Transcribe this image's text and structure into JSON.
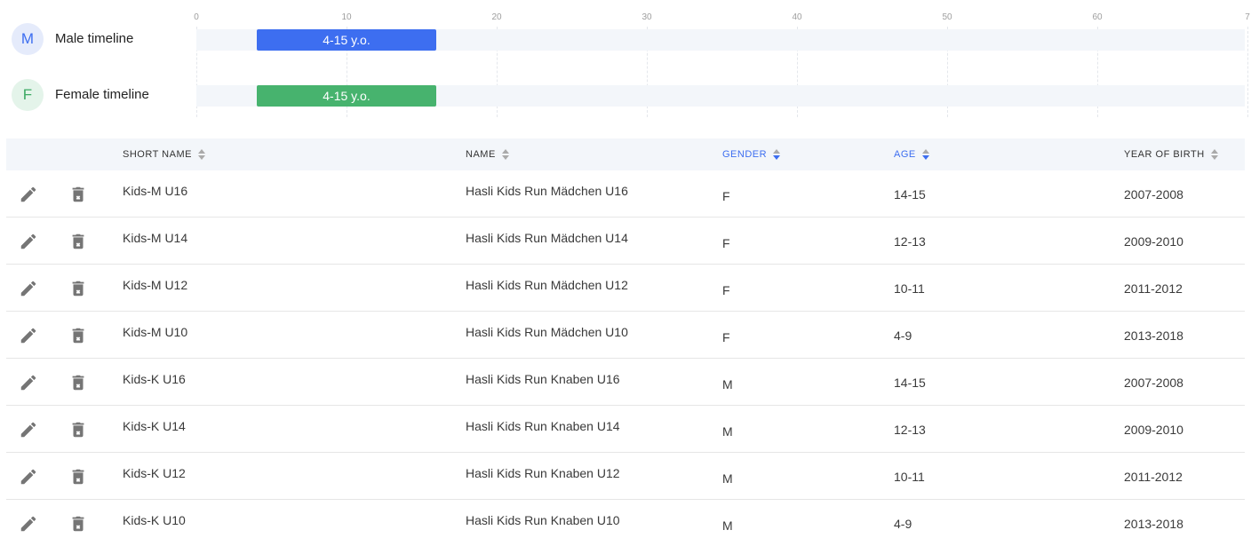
{
  "timeline": {
    "ticks": [
      "0",
      "10",
      "20",
      "30",
      "40",
      "50",
      "60",
      "7"
    ],
    "rows": [
      {
        "avatar": "M",
        "label": "Male timeline",
        "bar_label": "4-15 y.o.",
        "start": 4,
        "end": 16,
        "color": "#3d6ef0"
      },
      {
        "avatar": "F",
        "label": "Female timeline",
        "bar_label": "4-15 y.o.",
        "start": 4,
        "end": 16,
        "color": "#47b36e"
      }
    ]
  },
  "table": {
    "headers": {
      "short_name": "SHORT NAME",
      "name": "NAME",
      "gender": "GENDER",
      "age": "AGE",
      "year_of_birth": "YEAR OF BIRTH"
    },
    "accent_color": "#3d6ef0",
    "rows": [
      {
        "short_name": "Kids-M U16",
        "name": "Hasli Kids Run Mädchen U16",
        "gender": "F",
        "age": "14-15",
        "year_of_birth": "2007-2008"
      },
      {
        "short_name": "Kids-M U14",
        "name": "Hasli Kids Run Mädchen U14",
        "gender": "F",
        "age": "12-13",
        "year_of_birth": "2009-2010"
      },
      {
        "short_name": "Kids-M U12",
        "name": "Hasli Kids Run Mädchen U12",
        "gender": "F",
        "age": "10-11",
        "year_of_birth": "2011-2012"
      },
      {
        "short_name": "Kids-M U10",
        "name": "Hasli Kids Run Mädchen U10",
        "gender": "F",
        "age": "4-9",
        "year_of_birth": "2013-2018"
      },
      {
        "short_name": "Kids-K U16",
        "name": "Hasli Kids Run Knaben U16",
        "gender": "M",
        "age": "14-15",
        "year_of_birth": "2007-2008"
      },
      {
        "short_name": "Kids-K U14",
        "name": "Hasli Kids Run Knaben U14",
        "gender": "M",
        "age": "12-13",
        "year_of_birth": "2009-2010"
      },
      {
        "short_name": "Kids-K U12",
        "name": "Hasli Kids Run Knaben U12",
        "gender": "M",
        "age": "10-11",
        "year_of_birth": "2011-2012"
      },
      {
        "short_name": "Kids-K U10",
        "name": "Hasli Kids Run Knaben U10",
        "gender": "M",
        "age": "4-9",
        "year_of_birth": "2013-2018"
      }
    ]
  },
  "icons": {
    "edit": "pencil-icon",
    "delete": "trash-icon",
    "sort": "sort-icon"
  }
}
